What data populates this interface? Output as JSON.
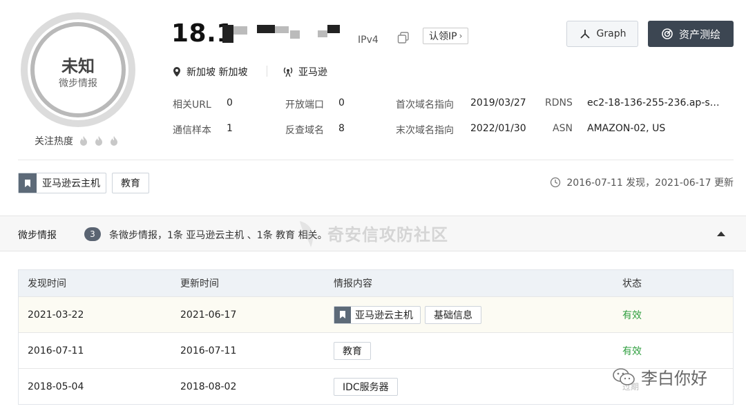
{
  "score": {
    "title": "未知",
    "subtitle": "微步情报"
  },
  "heat": {
    "label": "关注热度"
  },
  "header": {
    "ip": "18.1",
    "ip_type": "IPv4",
    "claim_label": "认领IP",
    "graph_label": "Graph",
    "asset_label": "资产测绘",
    "location": "新加坡 新加坡",
    "isp": "亚马逊"
  },
  "meta": {
    "rel_url_k": "相关URL",
    "rel_url_v": "0",
    "open_port_k": "开放端口",
    "open_port_v": "0",
    "first_dns_k": "首次域名指向",
    "first_dns_v": "2019/03/27",
    "rdns_k": "RDNS",
    "rdns_v": "ec2-18-136-255-236.ap-s…",
    "comm_k": "通信样本",
    "comm_v": "1",
    "rev_k": "反查域名",
    "rev_v": "8",
    "last_dns_k": "末次域名指向",
    "last_dns_v": "2022/01/30",
    "asn_k": "ASN",
    "asn_v": "AMAZON-02, US"
  },
  "tags": [
    "亚马逊云主机",
    "教育"
  ],
  "found_text": "2016-07-11 发现，2021-06-17 更新",
  "intel": {
    "title": "微步情报",
    "count": "3",
    "desc": "条微步情报，1条 亚马逊云主机 、1条 教育 相关。"
  },
  "watermark": "奇安信攻防社区",
  "table": {
    "headers": [
      "发现时间",
      "更新时间",
      "情报内容",
      "状态"
    ],
    "rows": [
      {
        "found": "2021-03-22",
        "updated": "2021-06-17",
        "tags": [
          "亚马逊云主机",
          "基础信息"
        ],
        "status": "有效"
      },
      {
        "found": "2016-07-11",
        "updated": "2016-07-11",
        "tags": [
          "教育"
        ],
        "status": "有效"
      },
      {
        "found": "2018-05-04",
        "updated": "2018-08-02",
        "tags": [
          "IDC服务器"
        ],
        "status": "过期"
      }
    ]
  },
  "wechat": "李白你好",
  "colors": {
    "valid": "#2e9e3e",
    "dark_button": "#3c4652",
    "badge": "#5a6472"
  }
}
